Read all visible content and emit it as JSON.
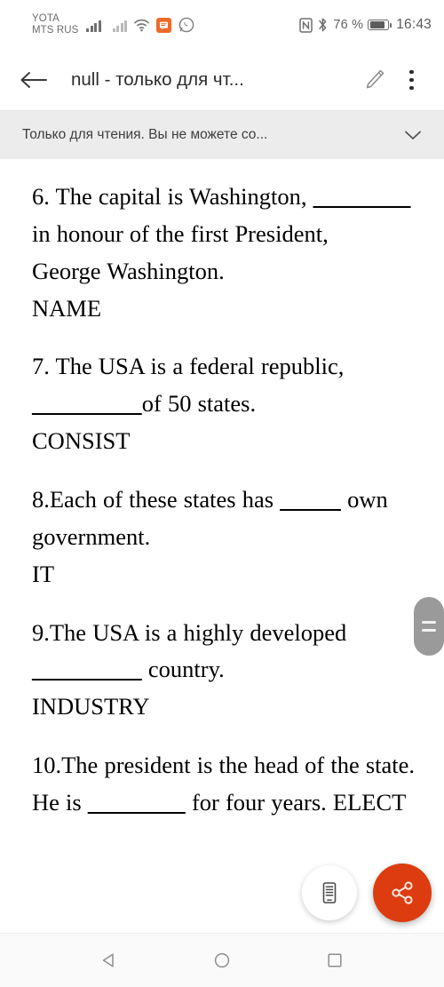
{
  "status_bar": {
    "carrier_line1": "YOTA",
    "carrier_line2": "MTS RUS",
    "battery_percent": "76 %",
    "clock": "16:43",
    "icons": {
      "signal_primary": "signal-bars-icon",
      "signal_secondary": "signal-bars-dim-icon",
      "wifi": "wifi-icon",
      "app_notification": "orange-app-icon",
      "whatsapp": "whatsapp-icon",
      "nfc": "nfc-icon",
      "bluetooth": "bluetooth-icon",
      "battery": "battery-icon"
    }
  },
  "app_bar": {
    "back_icon": "back-arrow-icon",
    "title": "null - только для чт...",
    "edit_icon": "pencil-edit-icon",
    "overflow_icon": "kebab-menu-icon"
  },
  "banner": {
    "message": "Только для чтения. Вы не можете со...",
    "expand_icon": "chevron-down-icon"
  },
  "document": {
    "paragraphs": [
      {
        "id": "q6",
        "segments": [
          {
            "type": "text",
            "value": "6. The capital is Washington, "
          },
          {
            "type": "blank",
            "value": "________"
          },
          {
            "type": "text",
            "value": " in honour of the first President,"
          }
        ]
      },
      {
        "id": "q6-answer",
        "segments": [
          {
            "type": "text",
            "value": "George Washington."
          }
        ]
      },
      {
        "id": "q6-cue",
        "segments": [
          {
            "type": "text",
            "value": "NAME"
          }
        ]
      },
      {
        "id": "q7",
        "segments": [
          {
            "type": "text",
            "value": "7. The USA is a federal republic, "
          },
          {
            "type": "blank",
            "value": "_________"
          },
          {
            "type": "text",
            "value": "of 50 states."
          }
        ]
      },
      {
        "id": "q7-cue",
        "segments": [
          {
            "type": "text",
            "value": "CONSIST"
          }
        ]
      },
      {
        "id": "q8",
        "segments": [
          {
            "type": "text",
            "value": "8.Each of these states has "
          },
          {
            "type": "blank",
            "value": "_____"
          },
          {
            "type": "text",
            "value": " own government."
          }
        ]
      },
      {
        "id": "q8-cue",
        "segments": [
          {
            "type": "text",
            "value": "IT"
          }
        ]
      },
      {
        "id": "q9",
        "segments": [
          {
            "type": "text",
            "value": "9.The USA is a highly developed "
          },
          {
            "type": "blank",
            "value": "_________"
          },
          {
            "type": "text",
            "value": "  country."
          }
        ]
      },
      {
        "id": "q9-cue",
        "segments": [
          {
            "type": "text",
            "value": "INDUSTRY"
          }
        ]
      },
      {
        "id": "q10",
        "segments": [
          {
            "type": "text",
            "value": "10.The president is the head of the state. He is "
          },
          {
            "type": "blank",
            "value": "________"
          },
          {
            "type": "text",
            "value": " for four years.  ELECT"
          }
        ]
      }
    ]
  },
  "scroll_handle": {
    "icon": "scroll-thumb-handle-icon"
  },
  "fabs": {
    "reader": {
      "icon": "mobile-reading-view-icon",
      "color": "#ffffff"
    },
    "share": {
      "icon": "share-icon",
      "color": "#dc3c10"
    }
  },
  "nav_bar": {
    "back": "nav-back-triangle-icon",
    "home": "nav-home-circle-icon",
    "recents": "nav-recents-square-icon"
  }
}
